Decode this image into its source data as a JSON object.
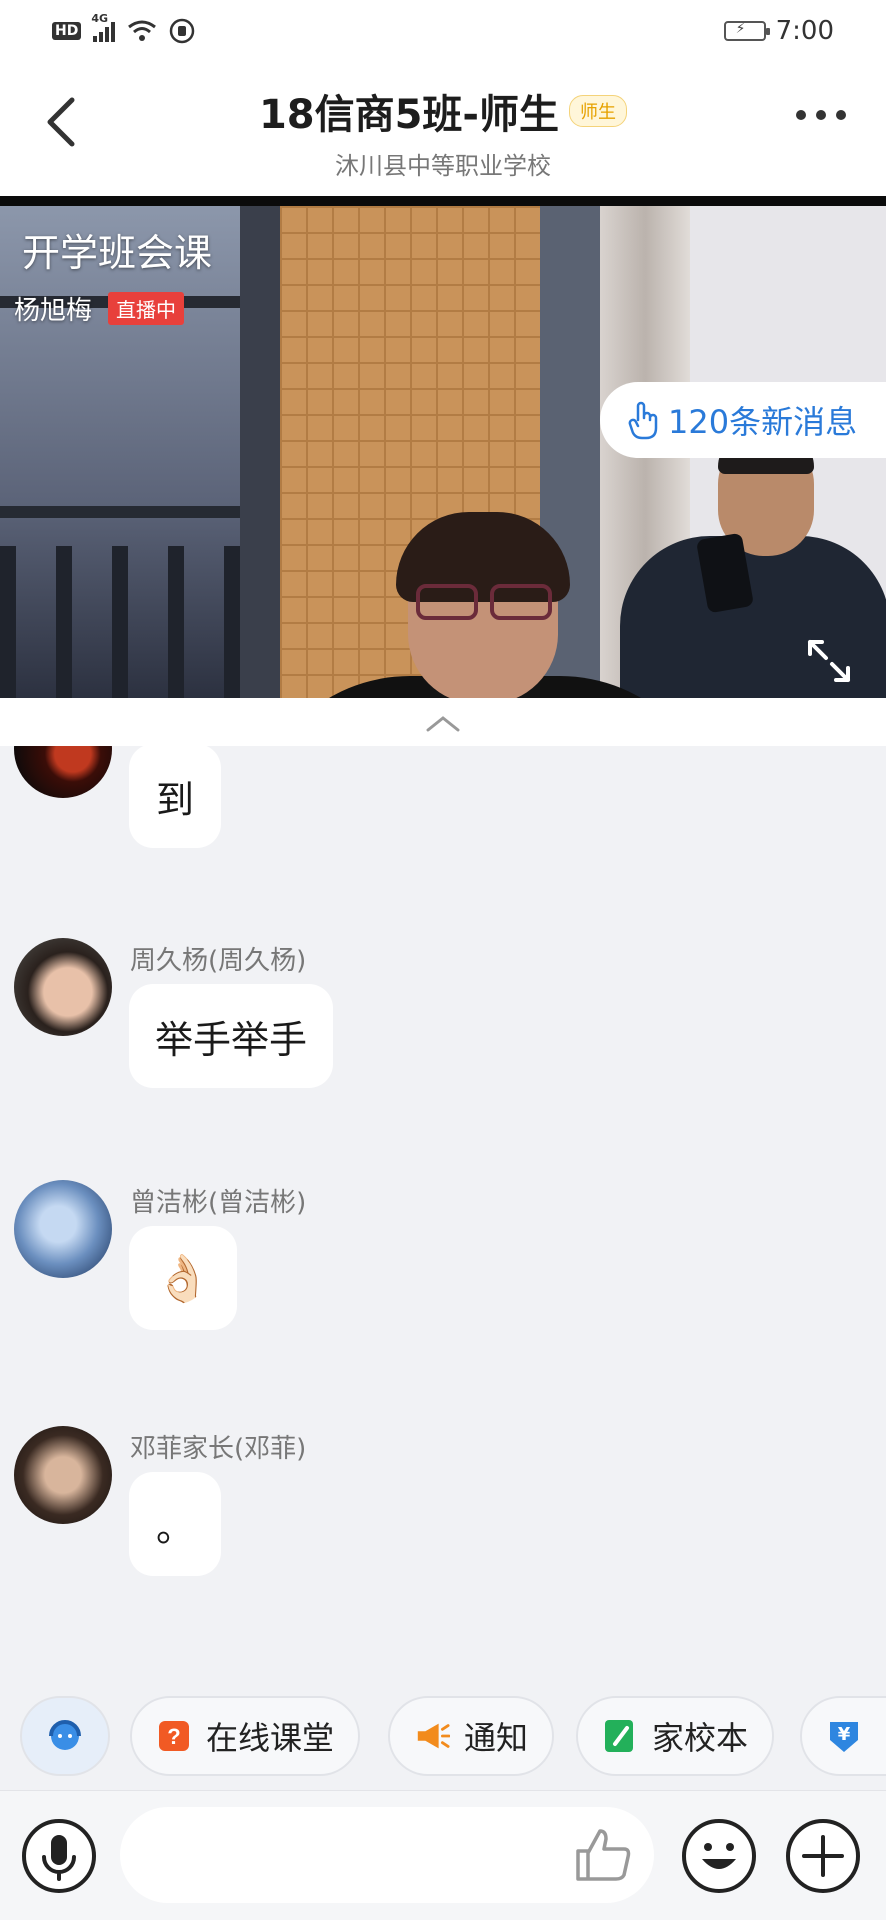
{
  "status_bar": {
    "hd": "HD",
    "network": "4G",
    "time": "7:00"
  },
  "header": {
    "title": "18信商5班-师生",
    "role_badge": "师生",
    "subtitle": "沐川县中等职业学校"
  },
  "live": {
    "title": "开学班会课",
    "teacher": "杨旭梅",
    "status": "直播中",
    "new_messages": "120条新消息"
  },
  "messages": [
    {
      "sender": "",
      "text": "到",
      "avatar": "user-avatar-1"
    },
    {
      "sender": "周久杨(周久杨)",
      "text": "举手举手",
      "avatar": "user-avatar-2"
    },
    {
      "sender": "曾洁彬(曾洁彬)",
      "text": "👌🏻",
      "avatar": "user-avatar-3"
    },
    {
      "sender": "邓菲家长(邓菲)",
      "text": "。",
      "avatar": "user-avatar-4"
    }
  ],
  "quick_actions": [
    {
      "label": "",
      "icon": "assistant-icon"
    },
    {
      "label": "在线课堂",
      "icon": "online-class-icon"
    },
    {
      "label": "通知",
      "icon": "notice-megaphone-icon"
    },
    {
      "label": "家校本",
      "icon": "home-school-book-icon"
    },
    {
      "label": "",
      "icon": "payment-icon"
    }
  ],
  "input": {
    "placeholder": ""
  },
  "colors": {
    "accent_blue": "#2a7ad9",
    "live_red": "#e8403b",
    "badge_gold": "#e6a100",
    "online_class_orange": "#f15a24",
    "notice_orange": "#f28b1c",
    "book_green": "#23b05a",
    "payment_blue": "#2e86e0"
  }
}
